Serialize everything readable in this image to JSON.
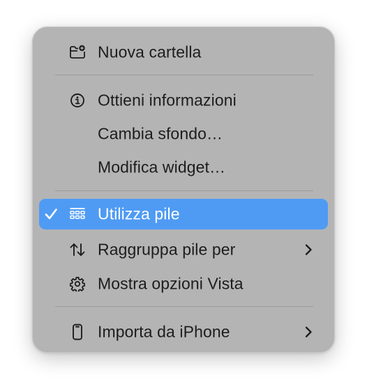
{
  "context_menu": {
    "items": [
      {
        "id": "new-folder",
        "label": "Nuova cartella",
        "icon": "folder-plus-icon"
      },
      {
        "id": "get-info",
        "label": "Ottieni informazioni",
        "icon": "info-circle-icon"
      },
      {
        "id": "change-wallpaper",
        "label": "Cambia sfondo…",
        "icon": ""
      },
      {
        "id": "edit-widgets",
        "label": "Modifica widget…",
        "icon": ""
      },
      {
        "id": "use-stacks",
        "label": "Utilizza pile",
        "icon": "stacks-grid-icon",
        "checked": true,
        "highlighted": true
      },
      {
        "id": "group-stacks-by",
        "label": "Raggruppa pile per",
        "icon": "sort-arrows-icon",
        "submenu": true
      },
      {
        "id": "show-view-options",
        "label": "Mostra opzioni Vista",
        "icon": "gear-icon"
      },
      {
        "id": "import-from-iphone",
        "label": "Importa da iPhone",
        "icon": "iphone-icon",
        "submenu": true
      }
    ]
  },
  "colors": {
    "menu_background": "#b4b4b4",
    "highlight": "#4f9bf4",
    "text": "#1d1d1f",
    "separator": "#9c9c9c"
  }
}
